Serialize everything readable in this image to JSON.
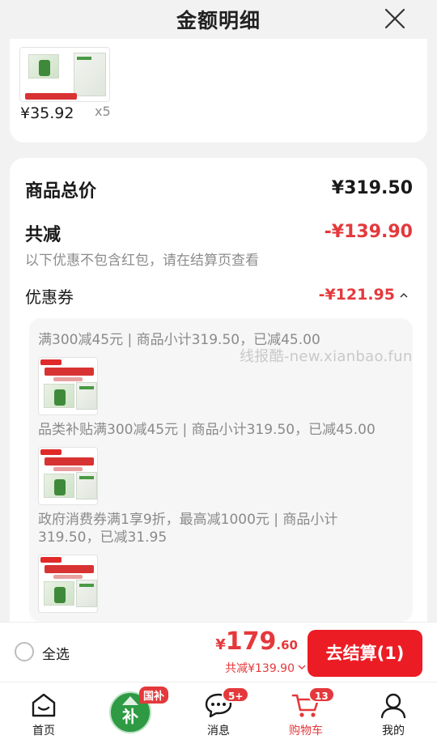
{
  "header": {
    "title": "金额明细"
  },
  "top_item": {
    "price": "¥35.92",
    "qty": "x5"
  },
  "summary": {
    "total_label": "商品总价",
    "total_value": "¥319.50",
    "reduce_label": "共减",
    "reduce_value": "-¥139.90",
    "note": "以下优惠不包含红包，请在结算页查看",
    "coupon_label": "优惠券",
    "coupon_value": "-¥121.95"
  },
  "coupons": [
    {
      "line1": "满300减45元 | 商品小计319.50，已减45.00"
    },
    {
      "line1": "品类补贴满300减45元 | 商品小计319.50，已减45.00"
    },
    {
      "line1": "政府消费券满1享9折，最高减1000元 | 商品小计",
      "line2": "319.50，已减31.95"
    }
  ],
  "watermark": "线报酷-new.xianbao.fun",
  "checkout": {
    "select_all": "全选",
    "currency": "¥",
    "price_int": "179",
    "price_dec": ".60",
    "saved": "共减¥139.90",
    "button": "去结算(1)"
  },
  "tabbar": {
    "home": "首页",
    "bubu_badge": "国补",
    "bubu_char": "补",
    "messages": "消息",
    "messages_badge": "5+",
    "cart": "购物车",
    "cart_badge": "13",
    "mine": "我的"
  },
  "colors": {
    "accent": "#e4393c",
    "button": "#ec1c24",
    "bubu_green": "#2e9a44"
  }
}
